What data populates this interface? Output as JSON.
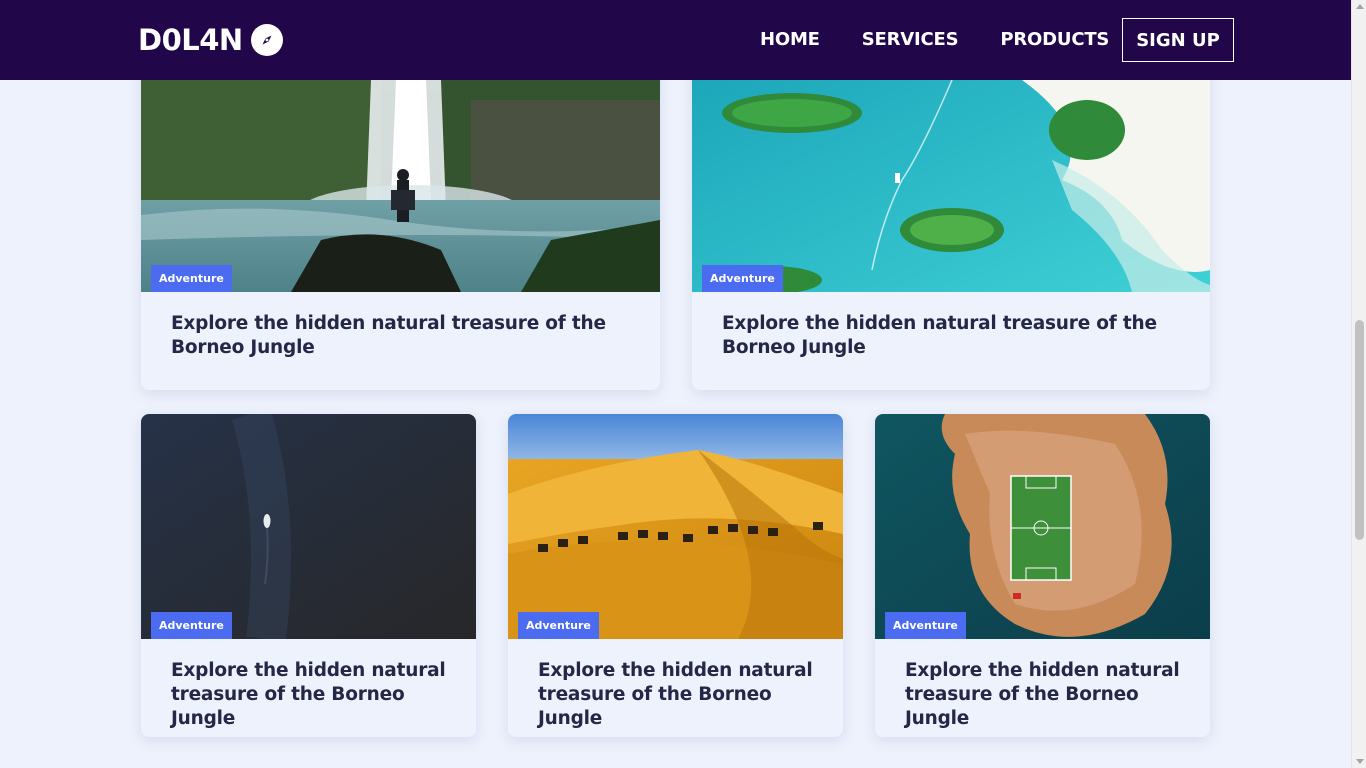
{
  "brand": {
    "name": "D0L4N",
    "icon": "compass-icon"
  },
  "nav": {
    "home": "HOME",
    "services": "SERVICES",
    "products": "PRODUCTS",
    "signup": "SIGN UP"
  },
  "colors": {
    "navbar_bg": "#21064a",
    "page_bg": "#eef2fc",
    "tag_bg": "#4b6cf0",
    "title_text": "#232846"
  },
  "cards": [
    {
      "tag": "Adventure",
      "title": "Explore the hidden natural treasure of the Borneo Jungle",
      "image": "waterfall-hiker"
    },
    {
      "tag": "Adventure",
      "title": "Explore the hidden natural treasure of the Borneo Jungle",
      "image": "aerial-islands"
    },
    {
      "tag": "Adventure",
      "title": "Explore the hidden natural treasure of the Borneo Jungle",
      "image": "boat-dark-sea"
    },
    {
      "tag": "Adventure",
      "title": "Explore the hidden natural treasure of the Borneo Jungle",
      "image": "desert-camels"
    },
    {
      "tag": "Adventure",
      "title": "Explore the hidden natural treasure of the Borneo Jungle",
      "image": "island-football-field"
    }
  ]
}
